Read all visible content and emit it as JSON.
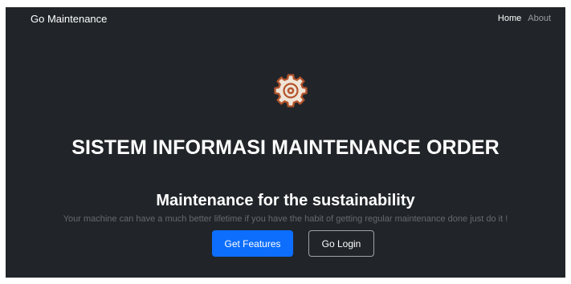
{
  "navbar": {
    "brand": "Go Maintenance",
    "links": [
      {
        "label": "Home",
        "active": true
      },
      {
        "label": "About",
        "active": false
      }
    ]
  },
  "hero": {
    "icon": "gear-icon",
    "title": "SISTEM INFORMASI MAINTENANCE ORDER",
    "subtitle": "Maintenance for the sustainability",
    "lead": "Your machine can have a much better lifetime if you have the habit of getting regular maintenance done just do it !",
    "buttons": {
      "primary": "Get Features",
      "secondary": "Go Login"
    }
  },
  "colors": {
    "background": "#212529",
    "primary": "#0d6efd",
    "gear_fill": "#efe4d6",
    "gear_outline": "#b3532c"
  }
}
